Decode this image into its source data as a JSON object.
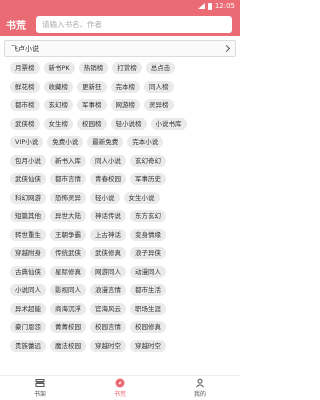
{
  "status_bar": {
    "time": "12:05"
  },
  "header": {
    "title": "书荒",
    "search_placeholder": "请输入书名、作者"
  },
  "category_select": {
    "selected": "飞卢小说"
  },
  "tag_rows": [
    [
      "月票榜",
      "新书PK",
      "热销榜",
      "打赏榜",
      "总点击"
    ],
    [
      "鲜花榜",
      "收藏榜",
      "更新狂",
      "完本榜",
      "同人榜"
    ],
    [
      "都市榜",
      "玄幻榜",
      "军事榜",
      "网游榜",
      "灵异榜"
    ],
    [
      "武侠榜",
      "女生榜",
      "校园榜",
      "轻小说榜",
      "小说书库"
    ],
    [
      "VIP小说",
      "免费小说",
      "最新免费",
      "完本小说"
    ],
    [
      "包月小说",
      "新书入库",
      "同人小说",
      "玄幻奇幻"
    ],
    [
      "武侠仙侠",
      "都市言情",
      "青春校园",
      "军事历史"
    ],
    [
      "科幻网游",
      "恐怖灵异",
      "轻小说",
      "女生小说"
    ],
    [
      "短篇其他",
      "异世大陆",
      "神话传说",
      "东方玄幻"
    ],
    [
      "转世重生",
      "王朝争霸",
      "上古神话",
      "变身情缘"
    ],
    [
      "穿越附身",
      "传统武侠",
      "武侠修真",
      "浪子异侠"
    ],
    [
      "古典仙侠",
      "星际修真",
      "网游同人",
      "动漫同人"
    ],
    [
      "小说同人",
      "影视同人",
      "浪漫言情",
      "都市生活"
    ],
    [
      "异术超能",
      "商海沉浮",
      "官海风云",
      "职场生涯"
    ],
    [
      "豪门恩怨",
      "菁菁校园",
      "校园言情",
      "校园修真"
    ],
    [
      "贵族蕾远",
      "魔法校园",
      "穿越时空",
      "穿越时空"
    ]
  ],
  "bottom_nav": [
    {
      "label": "书架",
      "icon": "bookshelf-icon"
    },
    {
      "label": "书荒",
      "icon": "compass-icon"
    },
    {
      "label": "我的",
      "icon": "user-icon"
    }
  ],
  "colors": {
    "accent": "#ea6b73",
    "tag_bg": "#eaeaea"
  }
}
